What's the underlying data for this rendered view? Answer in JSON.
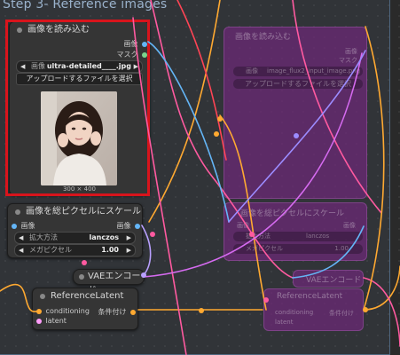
{
  "group": {
    "title": "Step 3- Reference images"
  },
  "load_image": {
    "title": "画像を読み込む",
    "output_image": "画像",
    "output_mask": "マスク",
    "image_label": "画像",
    "image_value": "ultra-detailed____.jpg",
    "upload_label": "アップロードするファイルを選択",
    "size_text": "300 × 400"
  },
  "scale_node": {
    "title": "画像を総ピクセルにスケール",
    "input_image": "画像",
    "output_image": "画像",
    "method_label": "拡大方法",
    "method_value": "lanczos",
    "megapixels_label": "メガピクセル",
    "megapixels_value": "1.00"
  },
  "vae_node": {
    "title": "VAEエンコード"
  },
  "ref_node": {
    "title": "ReferenceLatent",
    "input_conditioning": "conditioning",
    "input_latent": "latent",
    "output": "条件付け"
  },
  "ghost_load": {
    "title": "画像を読み込む",
    "output_image": "画像",
    "output_mask": "マスク",
    "image_label": "画像",
    "image_value": "image_flux2_input_image.png",
    "upload_label": "アップロードするファイルを選択"
  },
  "ghost_scale": {
    "title": "画像を総ピクセルにスケール",
    "input_image": "画像",
    "output_image": "画像",
    "method_label": "拡大方法",
    "method_value": "lanczos",
    "megapixels_label": "メガピクセル",
    "megapixels_value": "1.00"
  },
  "ghost_vae": {
    "title": "VAEエンコード"
  },
  "ghost_ref": {
    "title": "ReferenceLatent",
    "input_conditioning": "conditioning",
    "input_latent": "latent",
    "output": "条件付け"
  },
  "colors": {
    "image_port": "#64b5f6",
    "latent_port": "#ff9cf9",
    "conditioning_port": "#ffa931",
    "selection": "#d8141c",
    "ghost_node": "#6e2878"
  }
}
